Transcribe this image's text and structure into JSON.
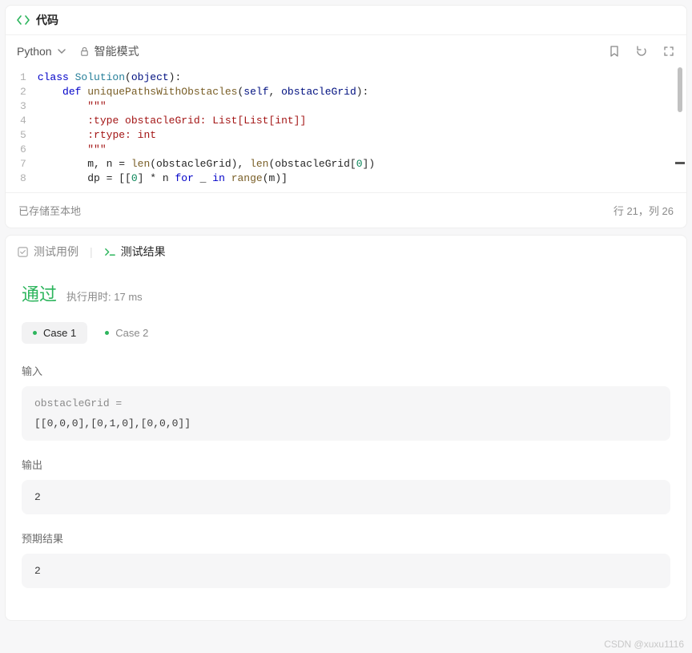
{
  "code_panel": {
    "title": "代码",
    "language": "Python",
    "mode": "智能模式",
    "save_status": "已存储至本地",
    "cursor": "行 21，列 26",
    "lines": [
      {
        "n": 1,
        "tokens": [
          {
            "t": "class ",
            "c": "kw"
          },
          {
            "t": "Solution",
            "c": "cls"
          },
          {
            "t": "(",
            "c": ""
          },
          {
            "t": "object",
            "c": "id"
          },
          {
            "t": "):",
            "c": ""
          }
        ]
      },
      {
        "n": 2,
        "tokens": [
          {
            "t": "    ",
            "c": ""
          },
          {
            "t": "def ",
            "c": "kw"
          },
          {
            "t": "uniquePathsWithObstacles",
            "c": "fn"
          },
          {
            "t": "(",
            "c": ""
          },
          {
            "t": "self",
            "c": "id"
          },
          {
            "t": ", ",
            "c": ""
          },
          {
            "t": "obstacleGrid",
            "c": "id"
          },
          {
            "t": "):",
            "c": ""
          }
        ]
      },
      {
        "n": 3,
        "tokens": [
          {
            "t": "        ",
            "c": ""
          },
          {
            "t": "\"\"\"",
            "c": "str"
          }
        ]
      },
      {
        "n": 4,
        "tokens": [
          {
            "t": "        ",
            "c": ""
          },
          {
            "t": ":type obstacleGrid: List[List[int]]",
            "c": "str"
          }
        ]
      },
      {
        "n": 5,
        "tokens": [
          {
            "t": "        ",
            "c": ""
          },
          {
            "t": ":rtype: int",
            "c": "str"
          }
        ]
      },
      {
        "n": 6,
        "tokens": [
          {
            "t": "        ",
            "c": ""
          },
          {
            "t": "\"\"\"",
            "c": "str"
          }
        ]
      },
      {
        "n": 7,
        "tokens": [
          {
            "t": "        m, n = ",
            "c": ""
          },
          {
            "t": "len",
            "c": "fn"
          },
          {
            "t": "(obstacleGrid), ",
            "c": ""
          },
          {
            "t": "len",
            "c": "fn"
          },
          {
            "t": "(obstacleGrid[",
            "c": ""
          },
          {
            "t": "0",
            "c": "num"
          },
          {
            "t": "])",
            "c": ""
          }
        ]
      },
      {
        "n": 8,
        "tokens": [
          {
            "t": "        dp = [[",
            "c": ""
          },
          {
            "t": "0",
            "c": "num"
          },
          {
            "t": "] * n ",
            "c": ""
          },
          {
            "t": "for",
            "c": "kw"
          },
          {
            "t": " _ ",
            "c": ""
          },
          {
            "t": "in",
            "c": "kw"
          },
          {
            "t": " ",
            "c": ""
          },
          {
            "t": "range",
            "c": "fn"
          },
          {
            "t": "(m)]",
            "c": ""
          }
        ]
      }
    ]
  },
  "results": {
    "tab_testcase": "测试用例",
    "tab_result": "测试结果",
    "pass_label": "通过",
    "runtime_prefix": "执行用时: ",
    "runtime_value": "17 ms",
    "cases": [
      {
        "label": "Case 1",
        "active": true
      },
      {
        "label": "Case 2",
        "active": false
      }
    ],
    "input_label": "输入",
    "input_var": "obstacleGrid =",
    "input_value": "[[0,0,0],[0,1,0],[0,0,0]]",
    "output_label": "输出",
    "output_value": "2",
    "expected_label": "预期结果",
    "expected_value": "2"
  },
  "watermark": "CSDN @xuxu1116"
}
